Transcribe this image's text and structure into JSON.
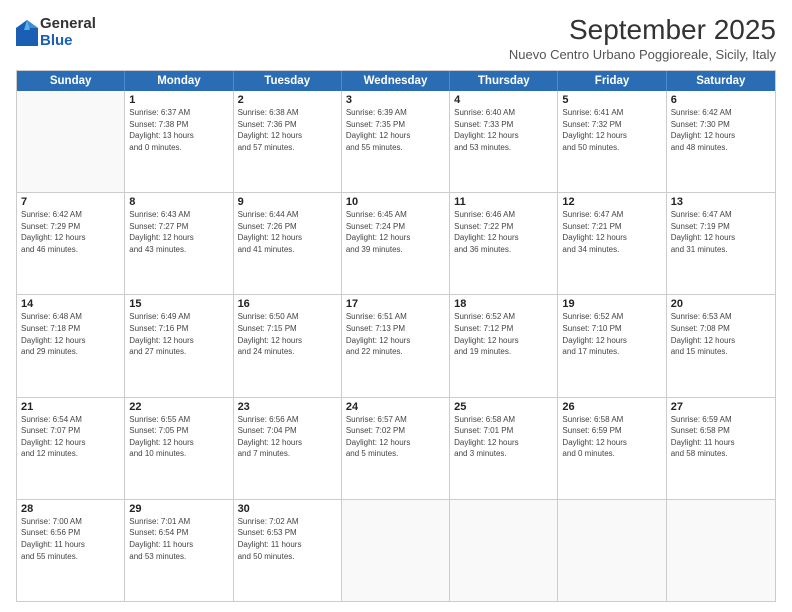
{
  "logo": {
    "general": "General",
    "blue": "Blue"
  },
  "title": "September 2025",
  "subtitle": "Nuevo Centro Urbano Poggioreale, Sicily, Italy",
  "header": {
    "days": [
      "Sunday",
      "Monday",
      "Tuesday",
      "Wednesday",
      "Thursday",
      "Friday",
      "Saturday"
    ]
  },
  "weeks": [
    [
      {
        "day": "",
        "info": ""
      },
      {
        "day": "1",
        "info": "Sunrise: 6:37 AM\nSunset: 7:38 PM\nDaylight: 13 hours\nand 0 minutes."
      },
      {
        "day": "2",
        "info": "Sunrise: 6:38 AM\nSunset: 7:36 PM\nDaylight: 12 hours\nand 57 minutes."
      },
      {
        "day": "3",
        "info": "Sunrise: 6:39 AM\nSunset: 7:35 PM\nDaylight: 12 hours\nand 55 minutes."
      },
      {
        "day": "4",
        "info": "Sunrise: 6:40 AM\nSunset: 7:33 PM\nDaylight: 12 hours\nand 53 minutes."
      },
      {
        "day": "5",
        "info": "Sunrise: 6:41 AM\nSunset: 7:32 PM\nDaylight: 12 hours\nand 50 minutes."
      },
      {
        "day": "6",
        "info": "Sunrise: 6:42 AM\nSunset: 7:30 PM\nDaylight: 12 hours\nand 48 minutes."
      }
    ],
    [
      {
        "day": "7",
        "info": "Sunrise: 6:42 AM\nSunset: 7:29 PM\nDaylight: 12 hours\nand 46 minutes."
      },
      {
        "day": "8",
        "info": "Sunrise: 6:43 AM\nSunset: 7:27 PM\nDaylight: 12 hours\nand 43 minutes."
      },
      {
        "day": "9",
        "info": "Sunrise: 6:44 AM\nSunset: 7:26 PM\nDaylight: 12 hours\nand 41 minutes."
      },
      {
        "day": "10",
        "info": "Sunrise: 6:45 AM\nSunset: 7:24 PM\nDaylight: 12 hours\nand 39 minutes."
      },
      {
        "day": "11",
        "info": "Sunrise: 6:46 AM\nSunset: 7:22 PM\nDaylight: 12 hours\nand 36 minutes."
      },
      {
        "day": "12",
        "info": "Sunrise: 6:47 AM\nSunset: 7:21 PM\nDaylight: 12 hours\nand 34 minutes."
      },
      {
        "day": "13",
        "info": "Sunrise: 6:47 AM\nSunset: 7:19 PM\nDaylight: 12 hours\nand 31 minutes."
      }
    ],
    [
      {
        "day": "14",
        "info": "Sunrise: 6:48 AM\nSunset: 7:18 PM\nDaylight: 12 hours\nand 29 minutes."
      },
      {
        "day": "15",
        "info": "Sunrise: 6:49 AM\nSunset: 7:16 PM\nDaylight: 12 hours\nand 27 minutes."
      },
      {
        "day": "16",
        "info": "Sunrise: 6:50 AM\nSunset: 7:15 PM\nDaylight: 12 hours\nand 24 minutes."
      },
      {
        "day": "17",
        "info": "Sunrise: 6:51 AM\nSunset: 7:13 PM\nDaylight: 12 hours\nand 22 minutes."
      },
      {
        "day": "18",
        "info": "Sunrise: 6:52 AM\nSunset: 7:12 PM\nDaylight: 12 hours\nand 19 minutes."
      },
      {
        "day": "19",
        "info": "Sunrise: 6:52 AM\nSunset: 7:10 PM\nDaylight: 12 hours\nand 17 minutes."
      },
      {
        "day": "20",
        "info": "Sunrise: 6:53 AM\nSunset: 7:08 PM\nDaylight: 12 hours\nand 15 minutes."
      }
    ],
    [
      {
        "day": "21",
        "info": "Sunrise: 6:54 AM\nSunset: 7:07 PM\nDaylight: 12 hours\nand 12 minutes."
      },
      {
        "day": "22",
        "info": "Sunrise: 6:55 AM\nSunset: 7:05 PM\nDaylight: 12 hours\nand 10 minutes."
      },
      {
        "day": "23",
        "info": "Sunrise: 6:56 AM\nSunset: 7:04 PM\nDaylight: 12 hours\nand 7 minutes."
      },
      {
        "day": "24",
        "info": "Sunrise: 6:57 AM\nSunset: 7:02 PM\nDaylight: 12 hours\nand 5 minutes."
      },
      {
        "day": "25",
        "info": "Sunrise: 6:58 AM\nSunset: 7:01 PM\nDaylight: 12 hours\nand 3 minutes."
      },
      {
        "day": "26",
        "info": "Sunrise: 6:58 AM\nSunset: 6:59 PM\nDaylight: 12 hours\nand 0 minutes."
      },
      {
        "day": "27",
        "info": "Sunrise: 6:59 AM\nSunset: 6:58 PM\nDaylight: 11 hours\nand 58 minutes."
      }
    ],
    [
      {
        "day": "28",
        "info": "Sunrise: 7:00 AM\nSunset: 6:56 PM\nDaylight: 11 hours\nand 55 minutes."
      },
      {
        "day": "29",
        "info": "Sunrise: 7:01 AM\nSunset: 6:54 PM\nDaylight: 11 hours\nand 53 minutes."
      },
      {
        "day": "30",
        "info": "Sunrise: 7:02 AM\nSunset: 6:53 PM\nDaylight: 11 hours\nand 50 minutes."
      },
      {
        "day": "",
        "info": ""
      },
      {
        "day": "",
        "info": ""
      },
      {
        "day": "",
        "info": ""
      },
      {
        "day": "",
        "info": ""
      }
    ]
  ]
}
